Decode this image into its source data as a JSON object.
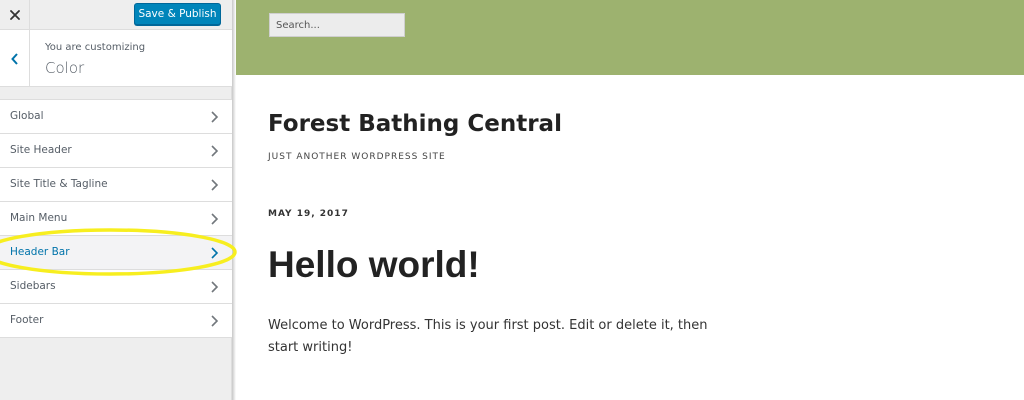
{
  "customizer": {
    "close_label": "Close",
    "publish_label": "Save & Publish",
    "customizing_label": "You are customizing",
    "section_title": "Color",
    "panels": [
      {
        "label": "Global"
      },
      {
        "label": "Site Header"
      },
      {
        "label": "Site Title & Tagline"
      },
      {
        "label": "Main Menu"
      },
      {
        "label": "Header Bar",
        "active": true
      },
      {
        "label": "Sidebars"
      },
      {
        "label": "Footer"
      }
    ]
  },
  "preview": {
    "search_placeholder": "Search...",
    "site_title": "Forest Bathing Central",
    "tagline": "JUST ANOTHER WORDPRESS SITE",
    "post": {
      "date": "MAY 19, 2017",
      "title": "Hello world!",
      "excerpt": "Welcome to WordPress. This is your first post. Edit or delete it, then start writing!"
    }
  },
  "colors": {
    "header_bar": "#9db26f",
    "publish_button": "#0085ba",
    "active_panel_text": "#0073aa",
    "highlight_ring": "#f7ee1f"
  },
  "icons": {
    "close": "close-icon",
    "back": "chevron-left-icon",
    "panel_arrow": "chevron-right-icon"
  }
}
